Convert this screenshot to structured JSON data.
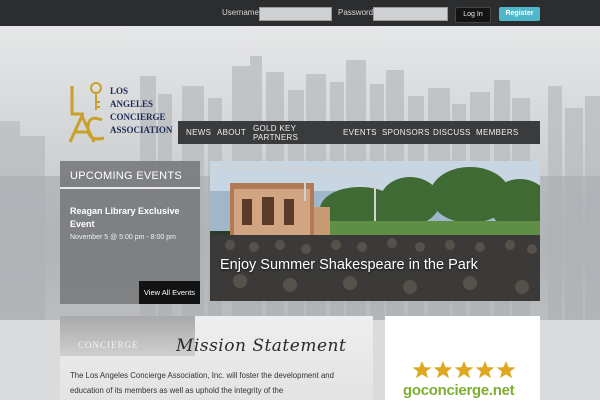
{
  "topbar": {
    "username_label": "Username",
    "password_label": "Password",
    "login_label": "Log In",
    "register_label": "Register"
  },
  "logo": {
    "lines": [
      "LOS",
      "ANGELES",
      "CONCIERGE",
      "ASSOCIATION"
    ]
  },
  "nav": {
    "items": [
      "NEWS",
      "ABOUT",
      "GOLD KEY",
      "PARTNERS",
      "EVENTS",
      "SPONSORS",
      "DISCUSS",
      "MEMBERS"
    ]
  },
  "events": {
    "title": "UPCOMING EVENTS",
    "event_name": "Reagan Library Exclusive Event",
    "event_date": "November 5 @ 5:00 pm - 8:00 pm",
    "view_all": "View All Events"
  },
  "slide": {
    "caption": "Enjoy Summer Shakespeare in the Park"
  },
  "mission": {
    "photo_word": "CONCIERGE",
    "title": "Mission Statement",
    "body": "The Los Angeles Concierge Association, Inc. will foster the development and education of its members as well as uphold the integrity of the"
  },
  "sponsor": {
    "name": "goconcierge.net",
    "star_count": 5
  },
  "colors": {
    "topbar": "#2b2d2f",
    "register": "#4fb7c9",
    "nav": "#3a3b3c",
    "sponsor_green": "#7dae31",
    "star_gold": "#e0a820"
  }
}
